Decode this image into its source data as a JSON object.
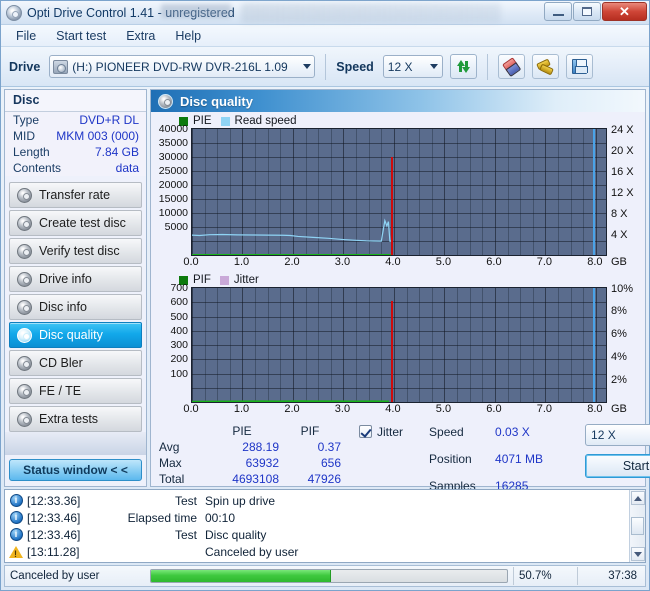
{
  "window": {
    "title": "Opti Drive Control 1.41 - unregistered",
    "app_icon": "disc-icon",
    "minimize_label": "–",
    "maximize_label": "□",
    "close_label": "✕"
  },
  "menu": {
    "items": [
      {
        "label": "File",
        "name": "menu-file"
      },
      {
        "label": "Start test",
        "name": "menu-start-test"
      },
      {
        "label": "Extra",
        "name": "menu-extra"
      },
      {
        "label": "Help",
        "name": "menu-help"
      }
    ]
  },
  "toolbar": {
    "drive_label": "Drive",
    "drive_value": "(H:)  PIONEER DVD-RW  DVR-216L 1.09",
    "drive_icon": "drive-icon",
    "speed_label": "Speed",
    "speed_value": "12 X",
    "refresh_icon": "refresh-icon",
    "erase_icon": "eraser-icon",
    "tools_icon": "tools-icon",
    "save_icon": "save-icon"
  },
  "disc_panel": {
    "header": "Disc",
    "rows": [
      {
        "label": "Type",
        "value": "DVD+R DL"
      },
      {
        "label": "MID",
        "value": "MKM 003 (000)"
      },
      {
        "label": "Length",
        "value": "7.84 GB"
      },
      {
        "label": "Contents",
        "value": "data"
      }
    ]
  },
  "sidebar": {
    "items": [
      {
        "label": "Transfer rate",
        "name": "sidebar-item-transfer-rate",
        "active": false
      },
      {
        "label": "Create test disc",
        "name": "sidebar-item-create-test-disc",
        "active": false
      },
      {
        "label": "Verify test disc",
        "name": "sidebar-item-verify-test-disc",
        "active": false
      },
      {
        "label": "Drive info",
        "name": "sidebar-item-drive-info",
        "active": false
      },
      {
        "label": "Disc info",
        "name": "sidebar-item-disc-info",
        "active": false
      },
      {
        "label": "Disc quality",
        "name": "sidebar-item-disc-quality",
        "active": true
      },
      {
        "label": "CD Bler",
        "name": "sidebar-item-cd-bler",
        "active": false
      },
      {
        "label": "FE / TE",
        "name": "sidebar-item-fe-te",
        "active": false
      },
      {
        "label": "Extra tests",
        "name": "sidebar-item-extra-tests",
        "active": false
      }
    ],
    "status_window_button": "Status window < <"
  },
  "main": {
    "header": "Disc quality",
    "header_icon": "disc-quality-icon"
  },
  "chart_data": [
    {
      "type": "line",
      "name": "pie-read-speed-chart",
      "title": "",
      "legend": [
        {
          "label": "PIE",
          "color": "#0d7a0d"
        },
        {
          "label": "Read speed",
          "color": "#8fd4f5"
        }
      ],
      "legend_position": "top-left",
      "xlabel": "GB",
      "x_ticks": [
        "0.0",
        "1.0",
        "2.0",
        "3.0",
        "4.0",
        "5.0",
        "6.0",
        "7.0",
        "8.0"
      ],
      "xlim": [
        0,
        8.2
      ],
      "ylabel": "",
      "y_ticks": [
        "40000",
        "35000",
        "30000",
        "25000",
        "20000",
        "15000",
        "10000",
        "5000"
      ],
      "ylim": [
        0,
        40000
      ],
      "y2_ticks": [
        "24 X",
        "20 X",
        "16 X",
        "12 X",
        "8 X",
        "4 X"
      ],
      "y2lim": [
        0,
        26
      ],
      "grid": true,
      "series": [
        {
          "name": "Read speed",
          "color": "#8fd4f5",
          "x": [
            0.0,
            0.15,
            0.35,
            0.6,
            0.9,
            1.2,
            1.5,
            1.8,
            1.95,
            2.1,
            2.4,
            2.7,
            3.0,
            3.2,
            3.45,
            3.6,
            3.75,
            3.82,
            3.86,
            3.89,
            3.92,
            3.95
          ],
          "y": [
            6300,
            6200,
            6450,
            6500,
            6400,
            6350,
            6300,
            6280,
            6200,
            5900,
            5600,
            5300,
            4900,
            4700,
            4500,
            4450,
            4400,
            10900,
            9200,
            10600,
            4400,
            4400
          ]
        },
        {
          "name": "PIE",
          "color": "#18b318",
          "x": [
            0.0,
            3.95
          ],
          "y": [
            0,
            0
          ]
        }
      ],
      "markers": [
        {
          "name": "position-marker",
          "x": 3.95,
          "color": "#cf0b0b",
          "height_fraction": 0.78
        },
        {
          "name": "disc-end-marker",
          "x": 7.95,
          "color": "#4aa3e8",
          "height_fraction": 1.0
        }
      ]
    },
    {
      "type": "line",
      "name": "pif-jitter-chart",
      "title": "",
      "legend": [
        {
          "label": "PIF",
          "color": "#0d7a0d"
        },
        {
          "label": "Jitter",
          "color": "#c9a9d8"
        }
      ],
      "legend_position": "top-left",
      "xlabel": "GB",
      "x_ticks": [
        "0.0",
        "1.0",
        "2.0",
        "3.0",
        "4.0",
        "5.0",
        "6.0",
        "7.0",
        "8.0"
      ],
      "xlim": [
        0,
        8.2
      ],
      "ylabel": "",
      "y_ticks": [
        "700",
        "600",
        "500",
        "400",
        "300",
        "200",
        "100"
      ],
      "ylim": [
        0,
        740
      ],
      "y2_ticks": [
        "10%",
        "8%",
        "6%",
        "4%",
        "2%"
      ],
      "y2lim": [
        0,
        10.5
      ],
      "grid": true,
      "series": [
        {
          "name": "PIF",
          "color": "#18b318",
          "x": [
            0.0,
            1.4,
            1.7,
            2.1,
            2.4,
            2.8,
            3.2,
            3.6,
            3.9
          ],
          "y": [
            2,
            4,
            3,
            5,
            4,
            4,
            3,
            4,
            3
          ]
        }
      ],
      "markers": [
        {
          "name": "position-marker",
          "x": 3.95,
          "color": "#cf0b0b",
          "height_fraction": 0.885
        },
        {
          "name": "disc-end-marker",
          "x": 7.95,
          "color": "#4aa3e8",
          "height_fraction": 1.0
        }
      ]
    }
  ],
  "stats": {
    "col_headers": [
      "PIE",
      "PIF"
    ],
    "rows": [
      {
        "label": "Avg",
        "pie": "288.19",
        "pif": "0.37"
      },
      {
        "label": "Max",
        "pie": "63932",
        "pif": "656"
      },
      {
        "label": "Total",
        "pie": "4693108",
        "pif": "47926"
      }
    ],
    "jitter_label": "Jitter",
    "jitter_checked": true,
    "speed_label": "Speed",
    "speed_value": "0.03 X",
    "position_label": "Position",
    "position_value": "4071 MB",
    "samples_label": "Samples",
    "samples_value": "16285",
    "speed_select_value": "12 X",
    "start_button": "Start"
  },
  "log": {
    "entries": [
      {
        "icon": "info-icon",
        "time": "[12:33.36]",
        "kind": "Test",
        "message": "Spin up drive"
      },
      {
        "icon": "info-icon",
        "time": "[12:33.46]",
        "kind": "Elapsed time",
        "message": "00:10"
      },
      {
        "icon": "info-icon",
        "time": "[12:33.46]",
        "kind": "Test",
        "message": "Disc quality"
      },
      {
        "icon": "warning-icon",
        "time": "[13:11.28]",
        "kind": "",
        "message": "Canceled by user"
      }
    ],
    "scroll_up_icon": "scroll-up-icon",
    "scroll_down_icon": "scroll-down-icon"
  },
  "statusbar": {
    "message": "Canceled by user",
    "progress_percent": "50.7%",
    "progress_value": 50.7,
    "time": "37:38"
  },
  "colors": {
    "accent": "#12a8ea",
    "plot_background": "#5a6c8d",
    "pie_green": "#18b318",
    "read_speed_blue": "#8fd4f5",
    "marker_red": "#cf0b0b",
    "progress_green": "#3fc93f",
    "value_text": "#1f36c7"
  }
}
